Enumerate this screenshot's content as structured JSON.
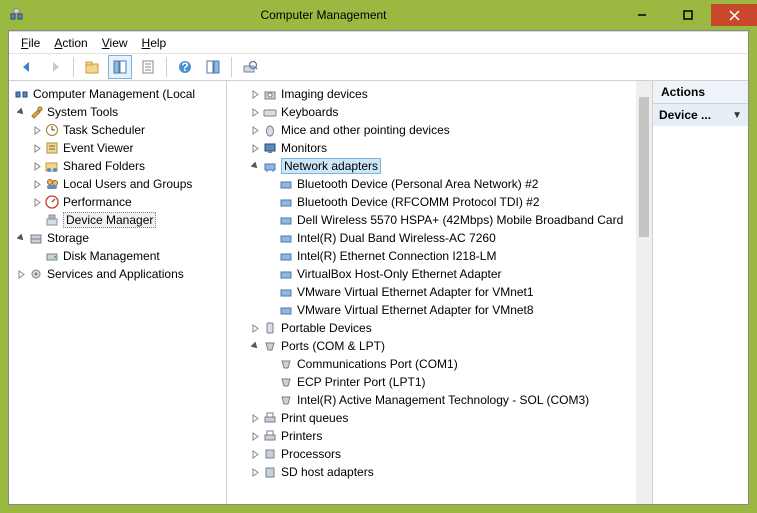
{
  "title": "Computer Management",
  "menu": {
    "file": "File",
    "action": "Action",
    "view": "View",
    "help": "Help"
  },
  "left": {
    "root": "Computer Management (Local",
    "system_tools": "System Tools",
    "task_scheduler": "Task Scheduler",
    "event_viewer": "Event Viewer",
    "shared_folders": "Shared Folders",
    "local_users": "Local Users and Groups",
    "performance": "Performance",
    "device_manager": "Device Manager",
    "storage": "Storage",
    "disk_management": "Disk Management",
    "services": "Services and Applications"
  },
  "center": {
    "imaging": "Imaging devices",
    "keyboards": "Keyboards",
    "mice": "Mice and other pointing devices",
    "monitors": "Monitors",
    "network": "Network adapters",
    "net_items": {
      "bt_pan": "Bluetooth Device (Personal Area Network) #2",
      "bt_rfcomm": "Bluetooth Device (RFCOMM Protocol TDI) #2",
      "dell_wwan": "Dell Wireless 5570 HSPA+ (42Mbps) Mobile Broadband Card",
      "intel_wifi": "Intel(R) Dual Band Wireless-AC 7260",
      "intel_eth": "Intel(R) Ethernet Connection I218-LM",
      "vbox": "VirtualBox Host-Only Ethernet Adapter",
      "vmnet1": "VMware Virtual Ethernet Adapter for VMnet1",
      "vmnet8": "VMware Virtual Ethernet Adapter for VMnet8"
    },
    "portable": "Portable Devices",
    "ports": "Ports (COM & LPT)",
    "port_items": {
      "com1": "Communications Port (COM1)",
      "lpt1": "ECP Printer Port (LPT1)",
      "intel_amt": "Intel(R) Active Management Technology - SOL (COM3)"
    },
    "print_queues": "Print queues",
    "printers": "Printers",
    "processors": "Processors",
    "sd_host": "SD host adapters"
  },
  "right": {
    "header": "Actions",
    "item1": "Device ..."
  }
}
